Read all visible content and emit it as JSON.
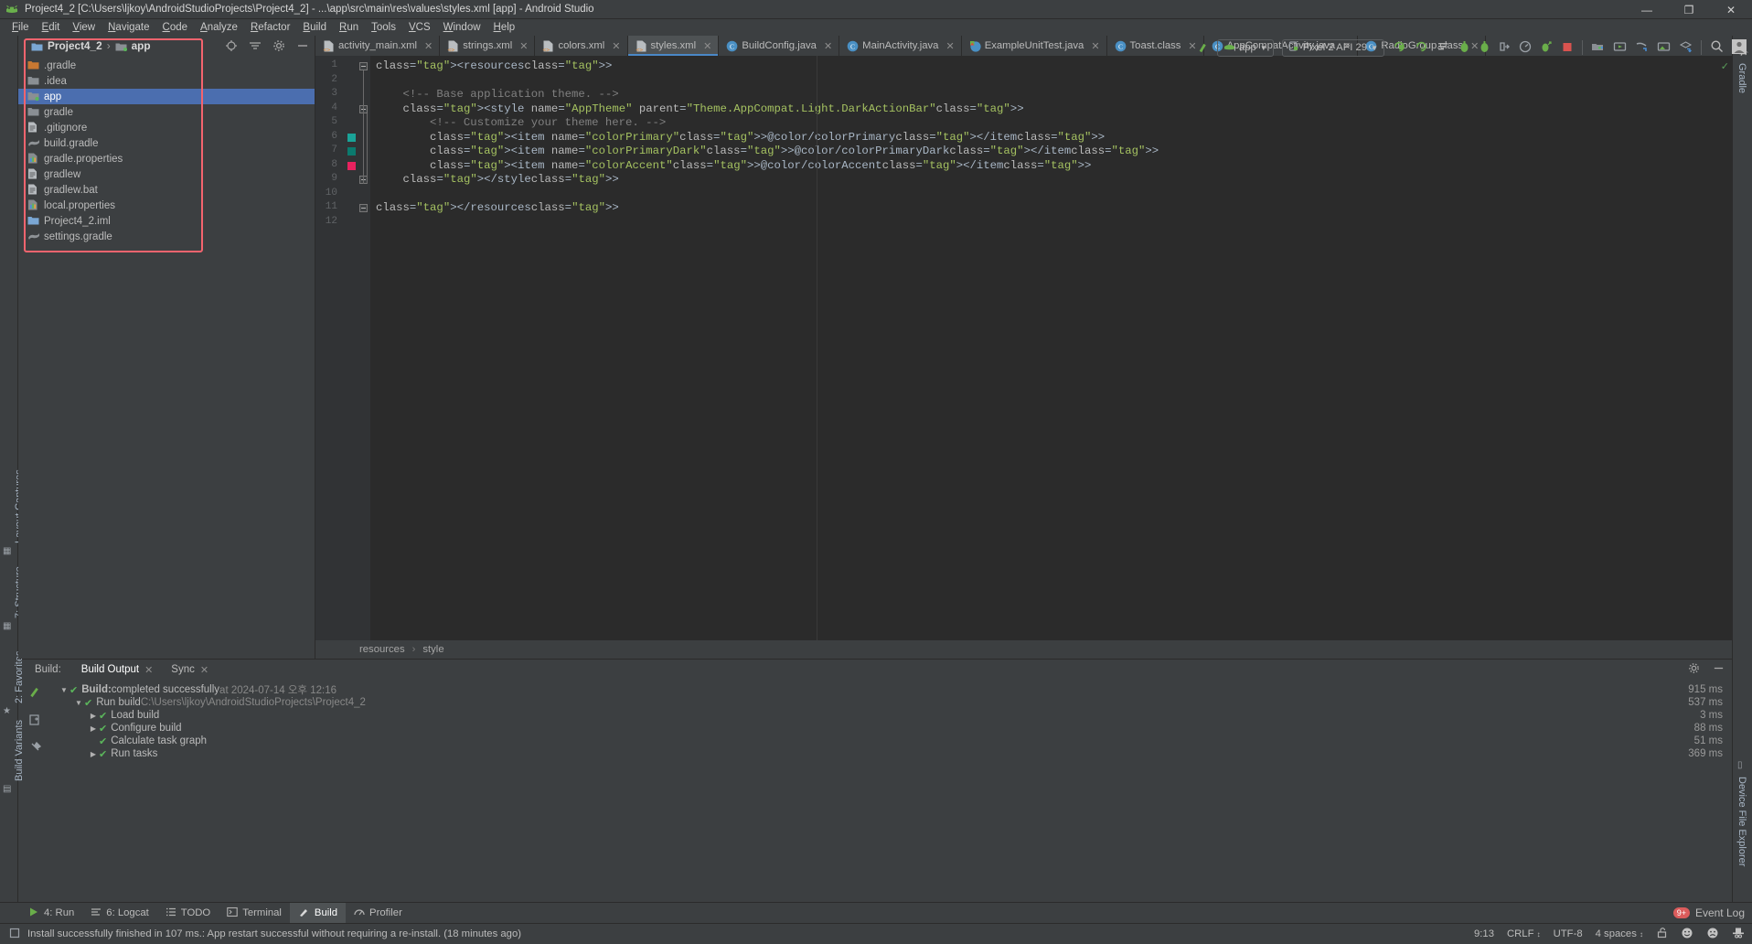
{
  "window": {
    "title": "Project4_2 [C:\\Users\\ljkoy\\AndroidStudioProjects\\Project4_2] - ...\\app\\src\\main\\res\\values\\styles.xml [app] - Android Studio",
    "minimize": "—",
    "maximize": "❐",
    "close": "✕"
  },
  "menu": [
    "File",
    "Edit",
    "View",
    "Navigate",
    "Code",
    "Analyze",
    "Refactor",
    "Build",
    "Run",
    "Tools",
    "VCS",
    "Window",
    "Help"
  ],
  "toolbar": {
    "module_selector": "app",
    "device_selector": "Pixel 2 API 29",
    "icons": [
      "hammer-icon",
      "run-icon",
      "debug-run-icon",
      "apply-changes-icon",
      "apply-code-changes-icon",
      "debug-icon",
      "attach-debugger-icon",
      "profiler-icon",
      "run-with-coverage-icon",
      "stop-icon",
      "sdk-manager-icon",
      "avd-manager-icon",
      "sync-gradle-icon",
      "layout-inspector-icon",
      "device-manager-icon",
      "search-icon",
      "avatar-icon"
    ]
  },
  "project_panel": {
    "breadcrumb": [
      "Project4_2",
      "app"
    ],
    "header_icons": [
      "locate-icon",
      "collapse-all-icon",
      "settings-icon",
      "hide-icon"
    ],
    "tree": [
      {
        "label": ".gradle",
        "icon": "folder-orange-icon",
        "selected": false
      },
      {
        "label": ".idea",
        "icon": "folder-icon",
        "selected": false
      },
      {
        "label": "app",
        "icon": "module-icon",
        "selected": true
      },
      {
        "label": "gradle",
        "icon": "folder-icon",
        "selected": false
      },
      {
        "label": ".gitignore",
        "icon": "file-icon",
        "selected": false
      },
      {
        "label": "build.gradle",
        "icon": "gradle-icon",
        "selected": false
      },
      {
        "label": "gradle.properties",
        "icon": "properties-icon",
        "selected": false
      },
      {
        "label": "gradlew",
        "icon": "file-icon",
        "selected": false
      },
      {
        "label": "gradlew.bat",
        "icon": "file-icon",
        "selected": false
      },
      {
        "label": "local.properties",
        "icon": "properties-icon",
        "selected": false
      },
      {
        "label": "Project4_2.iml",
        "icon": "iml-icon",
        "selected": false
      },
      {
        "label": "settings.gradle",
        "icon": "gradle-icon",
        "selected": false
      }
    ],
    "highlight_color": "#f4646e"
  },
  "editor": {
    "tabs": [
      {
        "label": "activity_main.xml",
        "icon": "xml-icon",
        "active": false
      },
      {
        "label": "strings.xml",
        "icon": "xml-icon",
        "active": false
      },
      {
        "label": "colors.xml",
        "icon": "xml-icon",
        "active": false
      },
      {
        "label": "styles.xml",
        "icon": "xml-icon",
        "active": true
      },
      {
        "label": "BuildConfig.java",
        "icon": "java-icon",
        "active": false
      },
      {
        "label": "MainActivity.java",
        "icon": "java-icon",
        "active": false
      },
      {
        "label": "ExampleUnitTest.java",
        "icon": "java-test-icon",
        "active": false
      },
      {
        "label": "Toast.class",
        "icon": "java-icon",
        "active": false
      },
      {
        "label": "AppCompatActivity.java",
        "icon": "java-icon",
        "active": false
      },
      {
        "label": "RadioGroup.class",
        "icon": "java-icon",
        "active": false
      }
    ],
    "line_numbers": [
      "1",
      "2",
      "3",
      "4",
      "5",
      "6",
      "7",
      "8",
      "9",
      "10",
      "11",
      "12"
    ],
    "gutter_color_marks": [
      {
        "line": 6,
        "color": "#1aa398"
      },
      {
        "line": 7,
        "color": "#0b7a6e"
      },
      {
        "line": 8,
        "color": "#e8225f"
      }
    ],
    "code_lines": [
      "<resources>",
      "",
      "    <!-- Base application theme. -->",
      "    <style name=\"AppTheme\" parent=\"Theme.AppCompat.Light.DarkActionBar\">",
      "        <!-- Customize your theme here. -->",
      "        <item name=\"colorPrimary\">@color/colorPrimary</item>",
      "        <item name=\"colorPrimaryDark\">@color/colorPrimaryDark</item>",
      "        <item name=\"colorAccent\">@color/colorAccent</item>",
      "    </style>",
      "",
      "</resources>",
      ""
    ],
    "breadcrumb": [
      "resources",
      "style"
    ]
  },
  "build_panel": {
    "label": "Build:",
    "tabs": [
      {
        "label": "Build Output",
        "active": true
      },
      {
        "label": "Sync",
        "active": false
      }
    ],
    "header_icons": [
      "settings-icon",
      "hide-icon"
    ],
    "side_icons": [
      "hammer-icon",
      "duplicate-icon",
      "pin-icon"
    ],
    "rows": [
      {
        "indent": 0,
        "arrow": "▼",
        "text": "Build:",
        "rest": " completed successfully",
        "dim": " at 2024-07-14 오후 12:16",
        "time": "915 ms",
        "bold": true
      },
      {
        "indent": 1,
        "arrow": "▼",
        "text": "Run build",
        "rest": "",
        "dim": " C:\\Users\\ljkoy\\AndroidStudioProjects\\Project4_2",
        "time": "537 ms",
        "bold": false
      },
      {
        "indent": 2,
        "arrow": "▶",
        "text": "Load build",
        "rest": "",
        "dim": "",
        "time": "3 ms",
        "bold": false
      },
      {
        "indent": 2,
        "arrow": "▶",
        "text": "Configure build",
        "rest": "",
        "dim": "",
        "time": "88 ms",
        "bold": false
      },
      {
        "indent": 2,
        "arrow": "",
        "text": "Calculate task graph",
        "rest": "",
        "dim": "",
        "time": "51 ms",
        "bold": false
      },
      {
        "indent": 2,
        "arrow": "▶",
        "text": "Run tasks",
        "rest": "",
        "dim": "",
        "time": "369 ms",
        "bold": false
      }
    ]
  },
  "left_strip": [
    {
      "label": "Layout Captures",
      "icon": "layout-captures-icon"
    },
    {
      "label": "7: Structure",
      "icon": "structure-icon"
    },
    {
      "label": "2: Favorites",
      "icon": "favorites-star-icon"
    },
    {
      "label": "Build Variants",
      "icon": "build-variants-icon"
    }
  ],
  "right_strip": [
    {
      "label": "Gradle",
      "icon": "gradle-elephant-icon"
    },
    {
      "label": "Device File Explorer",
      "icon": "device-file-explorer-icon"
    }
  ],
  "tool_windows": [
    {
      "label": "4: Run",
      "icon": "run-icon",
      "active": false
    },
    {
      "label": "6: Logcat",
      "icon": "logcat-icon",
      "active": false
    },
    {
      "label": "TODO",
      "icon": "todo-icon",
      "active": false
    },
    {
      "label": "Terminal",
      "icon": "terminal-icon",
      "active": false
    },
    {
      "label": "Build",
      "icon": "hammer-icon",
      "active": true
    },
    {
      "label": "Profiler",
      "icon": "profiler-icon",
      "active": false
    }
  ],
  "event_log": {
    "label": "Event Log",
    "badge": "9+"
  },
  "status_bar": {
    "message": "Install successfully finished in 107 ms.: App restart successful without requiring a re-install. (18 minutes ago)",
    "caret": "9:13",
    "line_sep": "CRLF",
    "encoding": "UTF-8",
    "indent": "4 spaces",
    "icons": [
      "lock-open-icon",
      "happy-face-icon",
      "sad-face-icon",
      "inspector-hat-icon"
    ]
  }
}
